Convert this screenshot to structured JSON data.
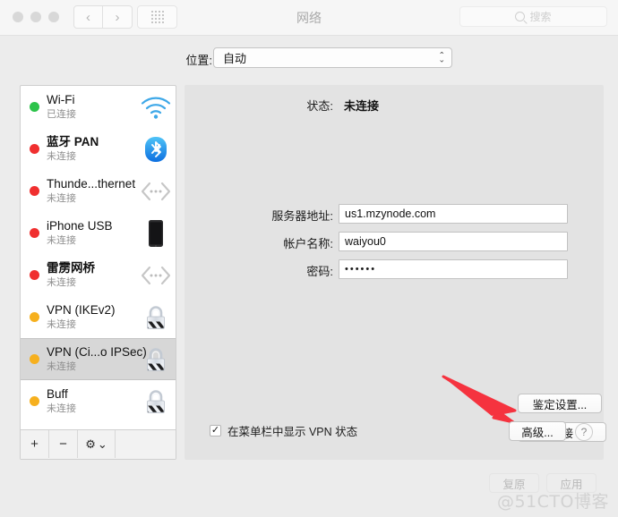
{
  "window": {
    "title": "网络",
    "traffic_lights": [
      "close",
      "minimize",
      "zoom"
    ]
  },
  "toolbar": {
    "back_label": "‹",
    "forward_label": "›",
    "grid_label": "grid",
    "search_placeholder": "搜索"
  },
  "location": {
    "label": "位置:",
    "value": "自动"
  },
  "sidebar": {
    "services": [
      {
        "name": "Wi-Fi",
        "status": "已连接",
        "dot": "#2cc34a",
        "icon": "wifi-icon",
        "bold": false,
        "selected": false
      },
      {
        "name": "蓝牙 PAN",
        "status": "未连接",
        "dot": "#f02f2f",
        "icon": "bluetooth-icon",
        "bold": true,
        "selected": false
      },
      {
        "name": "Thunde...thernet",
        "status": "未连接",
        "dot": "#f02f2f",
        "icon": "ethernet-icon",
        "bold": false,
        "selected": false
      },
      {
        "name": "iPhone USB",
        "status": "未连接",
        "dot": "#f02f2f",
        "icon": "iphone-icon",
        "bold": false,
        "selected": false
      },
      {
        "name": "雷雳网桥",
        "status": "未连接",
        "dot": "#f02f2f",
        "icon": "ethernet-icon",
        "bold": true,
        "selected": false
      },
      {
        "name": "VPN (IKEv2)",
        "status": "未连接",
        "dot": "#f6b01e",
        "icon": "lock-icon",
        "bold": false,
        "selected": false
      },
      {
        "name": "VPN (Ci...o IPSec)",
        "status": "未连接",
        "dot": "#f6b01e",
        "icon": "lock-icon",
        "bold": false,
        "selected": true
      },
      {
        "name": "Buff",
        "status": "未连接",
        "dot": "#f6b01e",
        "icon": "lock-icon",
        "bold": false,
        "selected": false
      }
    ],
    "footer": {
      "add_label": "+",
      "remove_label": "−",
      "gear_label": "⚙",
      "gear_chevron": "⌄"
    }
  },
  "main": {
    "status_label": "状态:",
    "status_value": "未连接",
    "fields": [
      {
        "label": "服务器地址:",
        "value": "us1.mzynode.com",
        "type": "text"
      },
      {
        "label": "帐户名称:",
        "value": "waiyou0",
        "type": "text"
      },
      {
        "label": "密码:",
        "value": "••••••",
        "type": "password"
      }
    ],
    "auth_settings_button": "鉴定设置...",
    "connect_button": "连接",
    "show_vpn_status_checkbox": {
      "label": "在菜单栏中显示 VPN 状态",
      "checked": true,
      "check_glyph": "✓"
    },
    "advanced_button": "高级...",
    "help_button": "?"
  },
  "bottom": {
    "revert_button": "复原",
    "apply_button": "应用"
  },
  "watermark": "@51CTO博客",
  "annotation": {
    "arrow_color": "#f5333f",
    "points_to": "鉴定设置..."
  }
}
